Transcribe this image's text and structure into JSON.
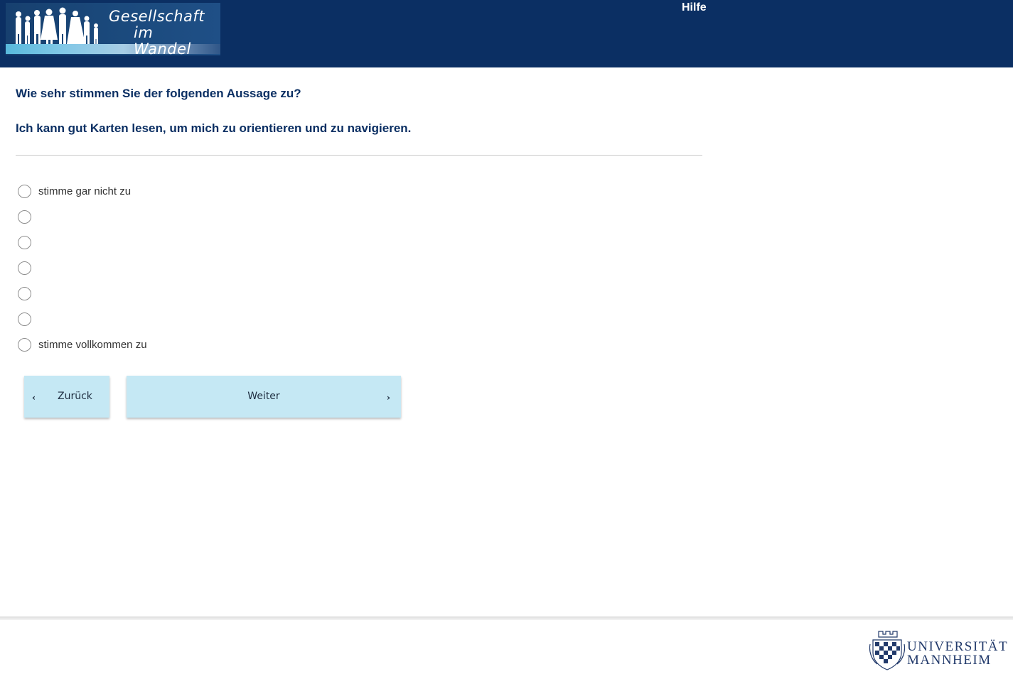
{
  "header": {
    "logo": {
      "line1": "Gesellschaft",
      "line2": "im Wandel"
    },
    "help_label": "Hilfe"
  },
  "question": {
    "title": "Wie sehr stimmen Sie der folgenden Aussage zu?",
    "statement": "Ich kann gut Karten lesen, um mich zu orientieren und zu navigieren."
  },
  "options": [
    {
      "label": "stimme gar nicht zu",
      "selected": false
    },
    {
      "label": "",
      "selected": false
    },
    {
      "label": "",
      "selected": false
    },
    {
      "label": "",
      "selected": false
    },
    {
      "label": "",
      "selected": false
    },
    {
      "label": "",
      "selected": false
    },
    {
      "label": "stimme vollkommen zu",
      "selected": false
    }
  ],
  "nav": {
    "back_label": "Zurück",
    "next_label": "Weiter",
    "back_icon": "chevron-left-icon",
    "next_icon": "chevron-right-icon"
  },
  "footer": {
    "university_line1": "UNIVERSITÄT",
    "university_line2": "MANNHEIM"
  },
  "colors": {
    "header_bg": "#0b2f63",
    "heading_text": "#0b2f63",
    "button_bg": "#c5e8f4"
  }
}
